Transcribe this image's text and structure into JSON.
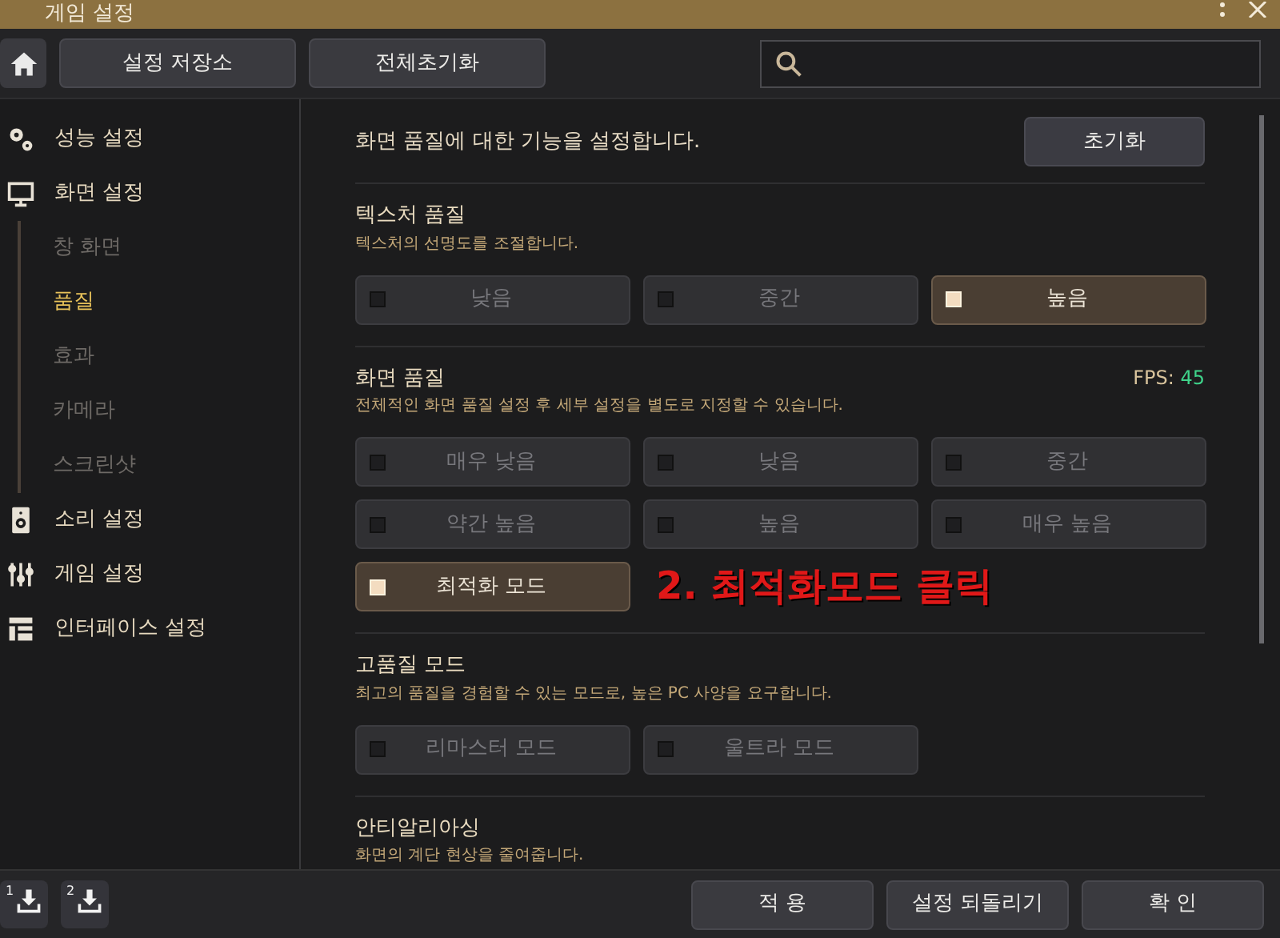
{
  "window": {
    "title": "게임 설정"
  },
  "toolbar": {
    "buttons": [
      "설정 저장소",
      "전체초기화"
    ]
  },
  "sidebar": {
    "items": [
      {
        "label": "성능 설정",
        "kind": "gears",
        "selected": false
      },
      {
        "label": "화면 설정",
        "kind": "monitor",
        "selected": false,
        "children": [
          {
            "label": "창 화면",
            "selected": false
          },
          {
            "label": "품질",
            "selected": true
          },
          {
            "label": "효과",
            "selected": false
          },
          {
            "label": "카메라",
            "selected": false
          },
          {
            "label": "스크린샷",
            "selected": false
          }
        ]
      },
      {
        "label": "소리 설정",
        "kind": "speaker",
        "selected": false
      },
      {
        "label": "게임 설정",
        "kind": "sliders",
        "selected": false
      },
      {
        "label": "인터페이스 설정",
        "kind": "layout",
        "selected": false
      }
    ]
  },
  "content": {
    "intro": "화면 품질에 대한 기능을 설정합니다.",
    "reset_button": "초기화",
    "sections": [
      {
        "title": "텍스처 품질",
        "description": "텍스처의 선명도를 조절합니다.",
        "options": [
          {
            "label": "낮음",
            "selected": false
          },
          {
            "label": "중간",
            "selected": false
          },
          {
            "label": "높음",
            "selected": true
          }
        ]
      },
      {
        "title": "화면 품질",
        "description": "전체적인 화면 품질 설정 후 세부 설정을 별도로 지정할 수 있습니다.",
        "fps_label": "FPS:",
        "fps_value": "45",
        "annotation": "2. 최적화모드 클릭",
        "options": [
          {
            "label": "매우 낮음",
            "selected": false
          },
          {
            "label": "낮음",
            "selected": false
          },
          {
            "label": "중간",
            "selected": false
          },
          {
            "label": "약간 높음",
            "selected": false
          },
          {
            "label": "높음",
            "selected": false
          },
          {
            "label": "매우 높음",
            "selected": false
          },
          {
            "label": "최적화 모드",
            "selected": true
          }
        ]
      },
      {
        "title": "고품질 모드",
        "description": "최고의 품질을 경험할 수 있는 모드로, 높은 PC 사양을 요구합니다.",
        "options": [
          {
            "label": "리마스터 모드",
            "selected": false
          },
          {
            "label": "울트라 모드",
            "selected": false
          }
        ]
      },
      {
        "title": "안티알리아싱",
        "description": "화면의 계단 현상을 줄여줍니다."
      }
    ]
  },
  "footer": {
    "slots": [
      "1",
      "2"
    ],
    "buttons": [
      "적 용",
      "설정 되돌리기",
      "확 인"
    ]
  }
}
